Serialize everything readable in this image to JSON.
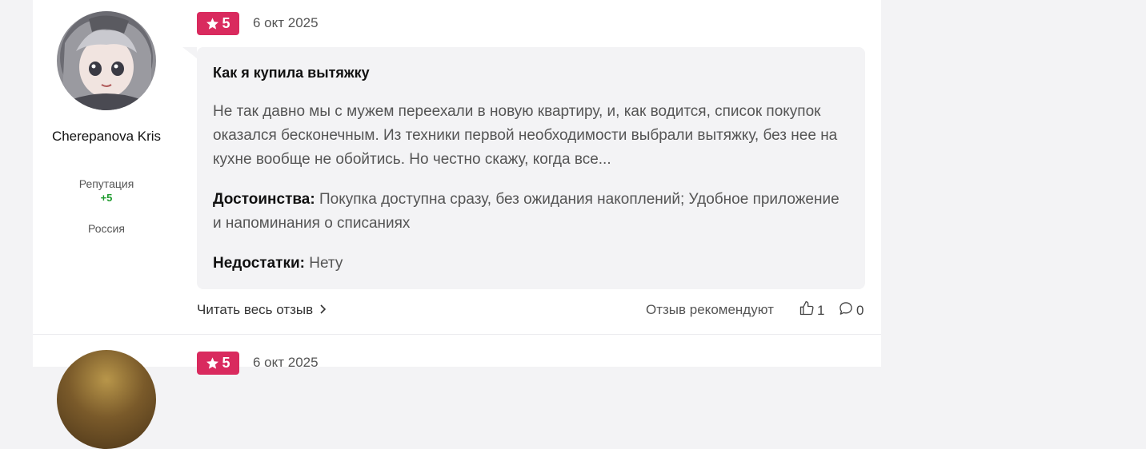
{
  "review": {
    "rating": "5",
    "date": "6 окт 2025",
    "title": "Как я купила вытяжку",
    "text": "Не так давно мы с мужем переехали в новую квартиру, и, как водится, список покупок оказался бесконечным. Из техники первой необходимости выбрали вытяжку, без нее на кухне вообще не обойтись. Но честно скажу, когда все...",
    "pros_label": "Достоинства:",
    "pros": "Покупка доступна сразу, без ожидания накоплений; Удобное приложение и напоминания о списаниях",
    "cons_label": "Недостатки:",
    "cons": "Нету",
    "read_more": "Читать весь отзыв",
    "recommend_label": "Отзыв рекомендуют",
    "likes": "1",
    "comments": "0"
  },
  "author": {
    "name": "Cherepanova Kris",
    "reputation_label": "Репутация",
    "reputation_value": "+5",
    "country": "Россия"
  },
  "next_review": {
    "rating": "5",
    "date": "6 окт 2025"
  },
  "colors": {
    "rating_badge": "#d92a5e",
    "reputation": "#1e9b2e",
    "bubble": "#f3f3f5"
  },
  "icons": [
    "star-icon",
    "chevron-right-icon",
    "thumbs-up-icon",
    "comment-icon"
  ]
}
